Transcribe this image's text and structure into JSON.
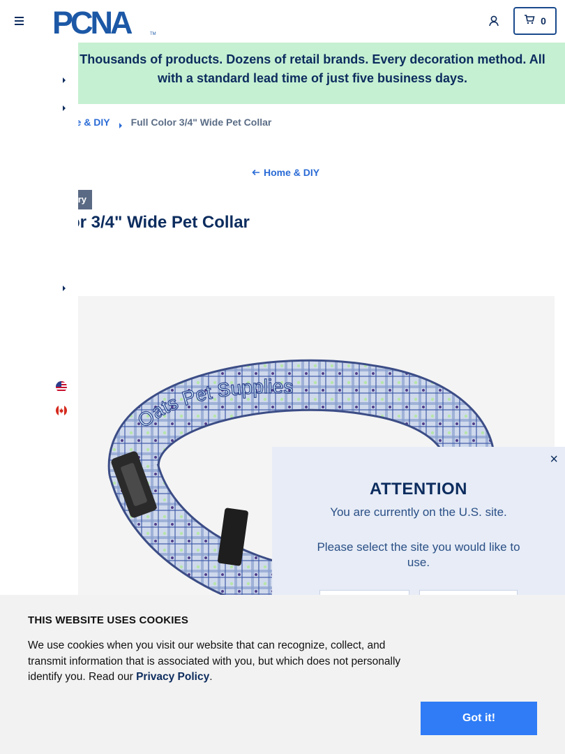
{
  "header": {
    "logo_text": "PCNA",
    "logo_tm": "TM",
    "cart_count": "0"
  },
  "promo": {
    "text": "Thousands of products. Dozens of retail brands. Every decoration method. All with a standard lead time of just five business days.",
    "partial_prefix": "/"
  },
  "breadcrumb": {
    "parent": "ne & DIY",
    "current": "Full Color 3/4\" Wide Pet Collar"
  },
  "back_link": "Home & DIY",
  "category_badge": "ry",
  "product_title": "or 3/4\" Wide Pet Collar",
  "collar_print_text": "Oats Pet Supplies",
  "modal": {
    "close_label": "×",
    "title": "ATTENTION",
    "line1": "You are currently on the U.S. site.",
    "line2": "Please select the site you would like to use."
  },
  "cookie": {
    "title": "THIS WEBSITE USES COOKIES",
    "body": "We use cookies when you visit our website that can recognize, collect, and transmit information that is associated with you, but which does not personally identify you. Read our ",
    "link": "Privacy Policy",
    "end": ".",
    "button": "Got it!"
  },
  "colors": {
    "navy": "#0c2c5e",
    "link_blue": "#2a6bd6",
    "promo_green": "#c6f0d2",
    "button_blue": "#2f7cf6"
  },
  "icons": [
    "menu-icon",
    "account-icon",
    "cart-icon",
    "caret-right-icon",
    "arrow-left-icon",
    "close-icon",
    "us-flag-icon",
    "canada-flag-icon"
  ]
}
